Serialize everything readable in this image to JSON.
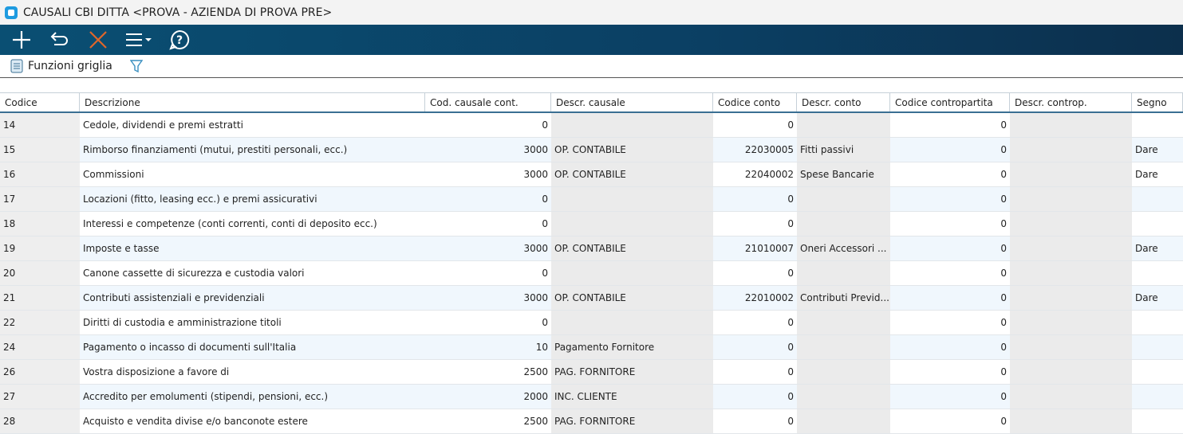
{
  "title": "CAUSALI CBI DITTA <PROVA - AZIENDA DI PROVA PRE>",
  "subtoolbar": {
    "grid_functions": "Funzioni griglia"
  },
  "columns": [
    "Codice",
    "Descrizione",
    "Cod. causale cont.",
    "Descr. causale",
    "Codice conto",
    "Descr. conto",
    "Codice contropartita",
    "Descr. controp.",
    "Segno"
  ],
  "rows": [
    [
      "14",
      "Cedole, dividendi e premi estratti",
      "0",
      "",
      "0",
      "",
      "0",
      "",
      ""
    ],
    [
      "15",
      "Rimborso finanziamenti (mutui, prestiti personali, ecc.)",
      "3000",
      "OP. CONTABILE",
      "22030005",
      "Fitti passivi",
      "0",
      "",
      "Dare"
    ],
    [
      "16",
      "Commissioni",
      "3000",
      "OP. CONTABILE",
      "22040002",
      "Spese Bancarie",
      "0",
      "",
      "Dare"
    ],
    [
      "17",
      "Locazioni (fitto, leasing ecc.) e premi assicurativi",
      "0",
      "",
      "0",
      "",
      "0",
      "",
      ""
    ],
    [
      "18",
      "Interessi e competenze (conti correnti, conti di deposito ecc.)",
      "0",
      "",
      "0",
      "",
      "0",
      "",
      ""
    ],
    [
      "19",
      "Imposte e tasse",
      "3000",
      "OP. CONTABILE",
      "21010007",
      "Oneri Accessori ...",
      "0",
      "",
      "Dare"
    ],
    [
      "20",
      "Canone cassette di sicurezza e custodia valori",
      "0",
      "",
      "0",
      "",
      "0",
      "",
      ""
    ],
    [
      "21",
      "Contributi assistenziali e previdenziali",
      "3000",
      "OP. CONTABILE",
      "22010002",
      "Contributi Previd...",
      "0",
      "",
      "Dare"
    ],
    [
      "22",
      "Diritti di custodia e amministrazione titoli",
      "0",
      "",
      "0",
      "",
      "0",
      "",
      ""
    ],
    [
      "24",
      "Pagamento o incasso di documenti sull'Italia",
      "10",
      "Pagamento Fornitore",
      "0",
      "",
      "0",
      "",
      ""
    ],
    [
      "26",
      "Vostra disposizione a favore di",
      "2500",
      "PAG. FORNITORE",
      "0",
      "",
      "0",
      "",
      ""
    ],
    [
      "27",
      "Accredito per emolumenti (stipendi, pensioni, ecc.)",
      "2000",
      "INC. CLIENTE",
      "0",
      "",
      "0",
      "",
      ""
    ],
    [
      "28",
      "Acquisto e vendita divise e/o banconote estere",
      "2500",
      "PAG. FORNITORE",
      "0",
      "",
      "0",
      "",
      ""
    ]
  ]
}
